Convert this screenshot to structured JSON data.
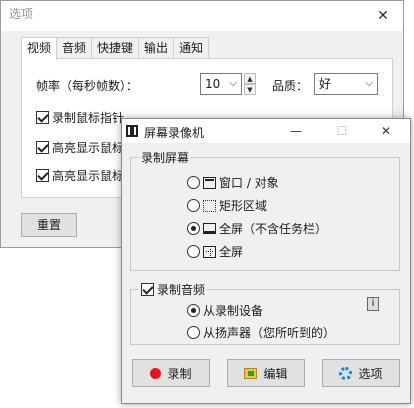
{
  "options_window": {
    "title": "选项",
    "close_glyph": "✕",
    "tabs": [
      "视频",
      "音频",
      "快捷键",
      "输出",
      "通知"
    ],
    "framerate_label": "帧率（每秒帧数）：",
    "framerate_value": "10",
    "quality_label": "品质：",
    "quality_value": "好",
    "checkboxes": [
      {
        "label": "录制鼠标指针",
        "checked": true
      },
      {
        "label": "高亮显示鼠标",
        "checked": true
      },
      {
        "label": "高亮显示鼠标",
        "checked": true
      }
    ],
    "reset_button": "重置"
  },
  "recorder_window": {
    "title": "屏幕录像机",
    "minimize_glyph": "—",
    "maximize_glyph": "☐",
    "close_glyph": "✕",
    "screen_group": {
      "label": "录制屏幕",
      "options": [
        {
          "label": "窗口 / 对象",
          "icon": "window-icon",
          "selected": false
        },
        {
          "label": "矩形区域",
          "icon": "rectangle-region-icon",
          "selected": false
        },
        {
          "label": "全屏（不含任务栏）",
          "icon": "screen-icon",
          "selected": true
        },
        {
          "label": "全屏",
          "icon": "fullscreen-icon",
          "selected": false
        }
      ]
    },
    "audio_group": {
      "label": "录制音频",
      "checked": true,
      "options": [
        {
          "label": "从录制设备",
          "selected": true
        },
        {
          "label": "从扬声器（您所听到的）",
          "selected": false
        }
      ]
    },
    "buttons": {
      "record": "录制",
      "edit": "编辑",
      "options": "选项"
    },
    "colors": {
      "record_dot": "#e8131b",
      "options_gear": "#2c7bb6"
    }
  }
}
